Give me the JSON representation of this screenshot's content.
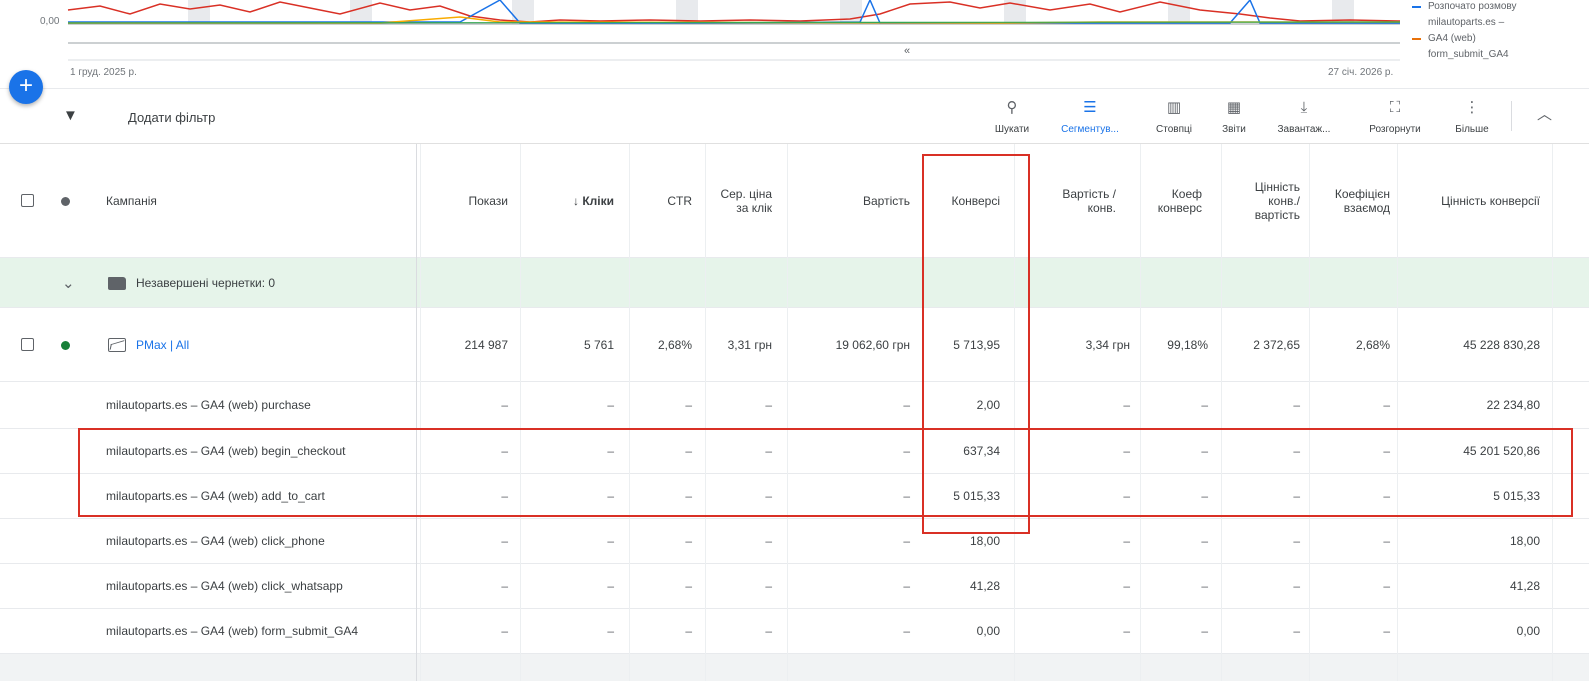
{
  "chart": {
    "y_label": "0,00",
    "start_date": "1 груд. 2025 р.",
    "end_date": "27 січ. 2026 р.",
    "scroll_handle": "«",
    "legend": [
      {
        "text": "Розпочато розмову",
        "color": "#1a73e8"
      },
      {
        "text": "milautoparts.es –",
        "color": ""
      },
      {
        "text": "GA4 (web)",
        "color": "#e8710a"
      },
      {
        "text": "form_submit_GA4",
        "color": ""
      }
    ]
  },
  "toolbar": {
    "add_filter": "Додати фільтр",
    "tools": [
      {
        "icon": "⚲",
        "label": "Шукати"
      },
      {
        "icon": "☰",
        "label": "Сегментув..."
      },
      {
        "icon": "▥",
        "label": "Стовпці"
      },
      {
        "icon": "▦",
        "label": "Звіти"
      },
      {
        "icon": "⤓",
        "label": "Завантаж..."
      },
      {
        "icon": "⛶",
        "label": "Розгорнути"
      },
      {
        "icon": "⋮",
        "label": "Більше"
      }
    ]
  },
  "table": {
    "columns": {
      "campaign": "Кампанія",
      "impressions": "Покази",
      "clicks": "↓ Кліки",
      "ctr": "CTR",
      "avg_cpc": "Сер. ціна за клік",
      "cost": "Вартість",
      "conversions": "Конверсі",
      "cost_per_conv": "Вартість / конв.",
      "conv_rate": "Коеф конверс",
      "value_per_cost": "Цінність конв./ вартість",
      "interaction_rate": "Коефіцієн взаємод",
      "conv_value": "Цінність конверсії"
    },
    "group_row": {
      "label": "Незавершені чернетки: 0"
    },
    "campaign_row": {
      "name": "PMax | All",
      "impressions": "214 987",
      "clicks": "5 761",
      "ctr": "2,68%",
      "avg_cpc": "3,31 грн",
      "cost": "19 062,60 грн",
      "conversions": "5 713,95",
      "cost_per_conv": "3,34 грн",
      "conv_rate": "99,18%",
      "value_per_cost": "2 372,65",
      "interaction_rate": "2,68%",
      "conv_value": "45 228 830,28"
    },
    "dash": "–",
    "sub_rows": [
      {
        "name": "milautoparts.es – GA4 (web) purchase",
        "conversions": "2,00",
        "conv_value": "22 234,80"
      },
      {
        "name": "milautoparts.es – GA4 (web) begin_checkout",
        "conversions": "637,34",
        "conv_value": "45 201 520,86"
      },
      {
        "name": "milautoparts.es – GA4 (web) add_to_cart",
        "conversions": "5 015,33",
        "conv_value": "5 015,33"
      },
      {
        "name": "milautoparts.es – GA4 (web) click_phone",
        "conversions": "18,00",
        "conv_value": "18,00"
      },
      {
        "name": "milautoparts.es – GA4 (web) click_whatsapp",
        "conversions": "41,28",
        "conv_value": "41,28"
      },
      {
        "name": "milautoparts.es – GA4 (web) form_submit_GA4",
        "conversions": "0,00",
        "conv_value": "0,00"
      }
    ]
  },
  "colors": {
    "accent": "#1a73e8",
    "highlight": "#d93025",
    "enabled": "#188038",
    "group_bg": "#e6f4ea"
  }
}
